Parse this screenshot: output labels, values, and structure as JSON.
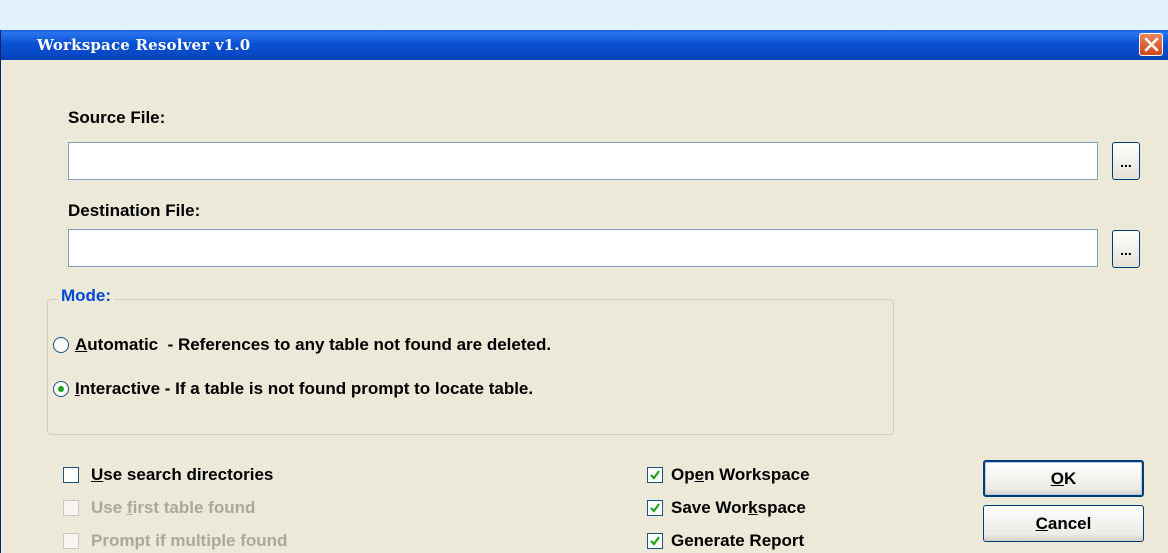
{
  "window": {
    "title": "Workspace Resolver v1.0"
  },
  "source": {
    "label": "Source File:",
    "value": "",
    "browse_label": "..."
  },
  "destination": {
    "label": "Destination File:",
    "value": "",
    "browse_label": "..."
  },
  "mode": {
    "legend": "Mode:",
    "automatic": {
      "mnemonic": "A",
      "rest": "utomatic  - References to any table not found are deleted.",
      "selected": false
    },
    "interactive": {
      "mnemonic": "I",
      "rest": "nteractive - If a table is not found prompt to locate table.",
      "selected": true
    }
  },
  "options": {
    "use_search_dirs": {
      "mnemonic": "U",
      "rest": "se search directories",
      "checked": false,
      "enabled": true
    },
    "use_first_table": {
      "pre": "Use ",
      "mnemonic": "f",
      "rest": "irst table found",
      "checked": false,
      "enabled": false
    },
    "prompt_multiple": {
      "label": "Prompt if multiple found",
      "checked": false,
      "enabled": false
    },
    "open_workspace": {
      "pre": "Op",
      "mnemonic": "e",
      "rest": "n Workspace",
      "checked": true
    },
    "save_workspace": {
      "pre": "Save Wor",
      "mnemonic": "k",
      "rest": "space",
      "checked": true
    },
    "generate_report": {
      "label": "Generate Report",
      "checked": true
    }
  },
  "buttons": {
    "ok": {
      "mnemonic": "O",
      "rest": "K"
    },
    "cancel": {
      "mnemonic": "C",
      "rest": "ancel"
    }
  },
  "colors": {
    "titlebar": "#0a52d4",
    "accent_group": "#0046d5",
    "dialog_bg": "#ece9d8",
    "check_mark": "#21a121"
  }
}
